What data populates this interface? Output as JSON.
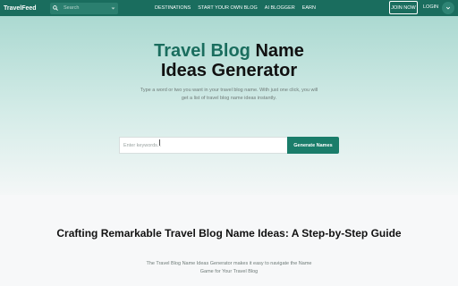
{
  "header": {
    "brand": "TravelFeed",
    "search_placeholder": "Search",
    "nav": [
      "DESTINATIONS",
      "START YOUR OWN BLOG",
      "AI BLOGGER",
      "EARN"
    ],
    "join": "JOIN NOW",
    "login": "LOGIN"
  },
  "hero": {
    "title_accent": "Travel Blog",
    "title_rest_line1": " Name",
    "title_line2": "Ideas Generator",
    "subtitle": "Type a word or two you want in your travel blog name. With just one click, you will get a list of travel blog name ideas instantly.",
    "input_placeholder": "Enter keywords...",
    "button": "Generate Names"
  },
  "guide": {
    "title": "Crafting Remarkable Travel Blog Name Ideas: A Step-by-Step Guide",
    "text": "The Travel Blog Name Ideas Generator makes it easy to navigate the Name Game for Your Travel Blog"
  },
  "colors": {
    "brand": "#1a6d5e",
    "button": "#1a7d6a"
  }
}
